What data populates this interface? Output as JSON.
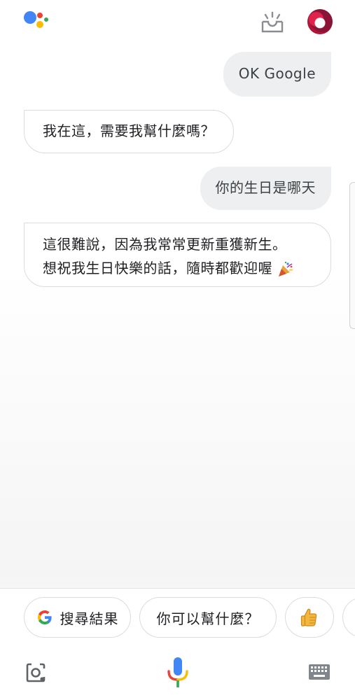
{
  "header": {
    "logo_icon": "google-assistant-logo-icon",
    "updates_icon": "snapshot-tray-icon",
    "avatar_icon": "user-avatar-icon"
  },
  "conversation": [
    {
      "role": "user",
      "text": "OK Google"
    },
    {
      "role": "assistant",
      "text": "我在這，需要我幫什麼嗎？"
    },
    {
      "role": "user",
      "text": "你的生日是哪天"
    },
    {
      "role": "assistant",
      "lines": [
        "這很難說，因為我常常更新重獲新生。",
        "想祝我生日快樂的話，隨時都歡迎喔"
      ],
      "trailing_emoji": "party-popper-icon"
    }
  ],
  "suggestions": [
    {
      "label": "搜尋結果",
      "icon": "google-g-icon"
    },
    {
      "label": "你可以幫什麼？"
    },
    {
      "icon": "thumbs-up-icon"
    }
  ],
  "bottom_bar": {
    "left_icon": "google-lens-icon",
    "center_icon": "microphone-icon",
    "right_icon": "keyboard-icon"
  },
  "colors": {
    "google_blue": "#4285F4",
    "google_red": "#EA4335",
    "google_yellow": "#FBBC05",
    "google_green": "#34A853",
    "user_bubble": "#EEEFF1"
  }
}
